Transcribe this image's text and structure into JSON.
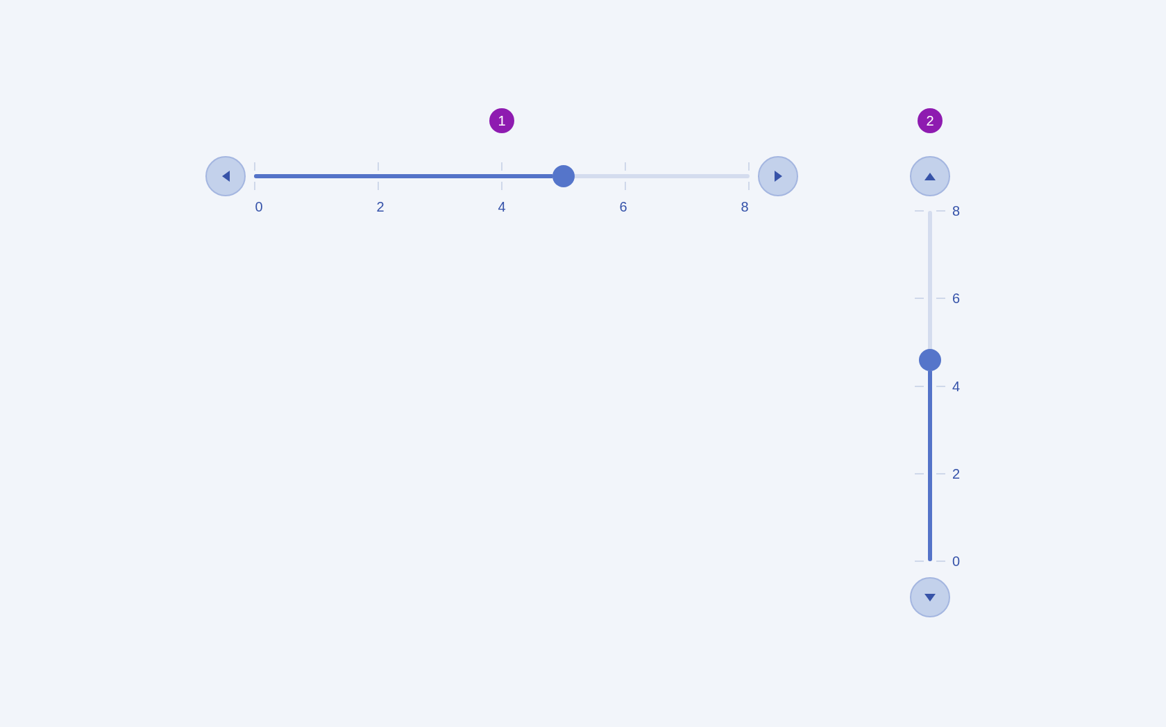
{
  "sliders": [
    {
      "kind": "horizontal",
      "marker": "1",
      "level": 0.625,
      "scale_labels": [
        "0",
        "2",
        "4",
        "6",
        "8"
      ]
    },
    {
      "kind": "vertical",
      "marker": "2",
      "level": 0.575,
      "scale_labels": [
        "8",
        "6",
        "4",
        "2",
        "0"
      ]
    }
  ]
}
